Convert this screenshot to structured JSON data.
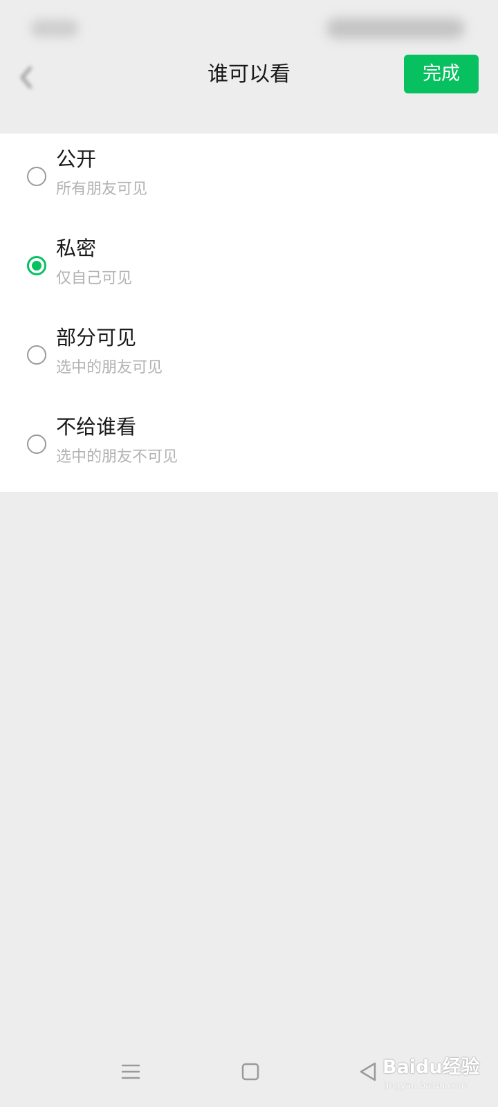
{
  "header": {
    "title": "谁可以看",
    "done_label": "完成"
  },
  "options": [
    {
      "label": "公开",
      "sub": "所有朋友可见",
      "selected": false
    },
    {
      "label": "私密",
      "sub": "仅自己可见",
      "selected": true
    },
    {
      "label": "部分可见",
      "sub": "选中的朋友可见",
      "selected": false
    },
    {
      "label": "不给谁看",
      "sub": "选中的朋友不可见",
      "selected": false
    }
  ],
  "colors": {
    "accent": "#07c160",
    "background": "#ededed",
    "list_background": "#ffffff",
    "title_text": "#191919",
    "sub_text": "#b2b2b2"
  },
  "icons": {
    "back": "back-arrow-icon",
    "nav_menu": "menu-icon",
    "nav_home": "home-icon",
    "nav_back": "back-triangle-icon"
  },
  "watermark": {
    "text": "Baidu经验",
    "url": "jingyan.baidu.com"
  }
}
